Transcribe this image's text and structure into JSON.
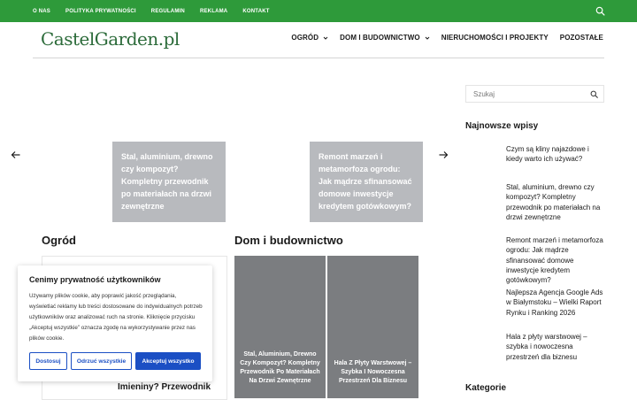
{
  "top_nav": {
    "items": [
      "O NAS",
      "POLITYKA PRYWATNOŚCI",
      "REGULAMIN",
      "REKLAMA",
      "KONTAKT"
    ]
  },
  "header": {
    "logo": "CastelGarden.pl",
    "menu": [
      {
        "label": "OGRÓD",
        "has_dropdown": true
      },
      {
        "label": "DOM I BUDOWNICTWO",
        "has_dropdown": true
      },
      {
        "label": "NIERUCHOMOŚCI I PROJEKTY",
        "has_dropdown": false
      },
      {
        "label": "POZOSTAŁE",
        "has_dropdown": false
      }
    ]
  },
  "slider": {
    "slides": [
      {
        "title": "Stal, aluminium, drewno czy kompozyt? Kompletny przewodnik po materiałach na drzwi zewnętrzne"
      },
      {
        "title": "Remont marzeń i metamorfoza ogrodu: Jak mądrze sfinansować domowe inwestycje kredytem gotówkowym?"
      }
    ]
  },
  "sections": {
    "ogrod": {
      "title": "Ogród",
      "card_title_partial": "Imieniny? Przewodnik"
    },
    "dom": {
      "title": "Dom i budownictwo",
      "tiles": [
        {
          "title": "Stal, Aluminium, Drewno Czy Kompozyt? Kompletny Przewodnik Po Materiałach Na Drzwi Zewnętrzne"
        },
        {
          "title": "Hala Z Płyty Warstwowej – Szybka I Nowoczesna Przestrzeń Dla Biznesu"
        }
      ]
    }
  },
  "sidebar": {
    "search_placeholder": "Szukaj",
    "recent_heading": "Najnowsze wpisy",
    "recent_posts": [
      "Czym są kliny najazdowe i kiedy warto ich używać?",
      "Stal, aluminium, drewno czy kompozyt? Kompletny przewodnik po materiałach na drzwi zewnętrzne",
      "Remont marzeń i metamorfoza ogrodu: Jak mądrze sfinansować domowe inwestycje kredytem gotówkowym?",
      "Najlepsza Agencja Google Ads w Białymstoku – Wielki Raport Rynku i Ranking 2026",
      "Hala z płyty warstwowej – szybka i nowoczesna przestrzeń dla biznesu"
    ],
    "categories_heading": "Kategorie"
  },
  "cookie": {
    "title": "Cenimy prywatność użytkowników",
    "text": "Używamy plików cookie, aby poprawić jakość przeglądania, wyświetlać reklamy lub treści dostosowane do indywidualnych potrzeb użytkowników oraz analizować ruch na stronie. Kliknięcie przycisku „Akceptuj wszystkie” oznacza zgodę na wykorzystywanie przez nas plików cookie.",
    "customize_label": "Dostosuj",
    "reject_label": "Odrzuć wszystkie",
    "accept_label": "Akceptuj wszystko"
  },
  "colors": {
    "topbar": "#2e9a3a",
    "logo": "#2c6b3a",
    "cookie_button": "#1b4fc4",
    "slide_bg": "#b8babe",
    "tile_bg": "#7b7d80"
  },
  "icons": [
    "search-icon",
    "chevron-down-icon",
    "arrow-left-icon",
    "arrow-right-icon"
  ]
}
